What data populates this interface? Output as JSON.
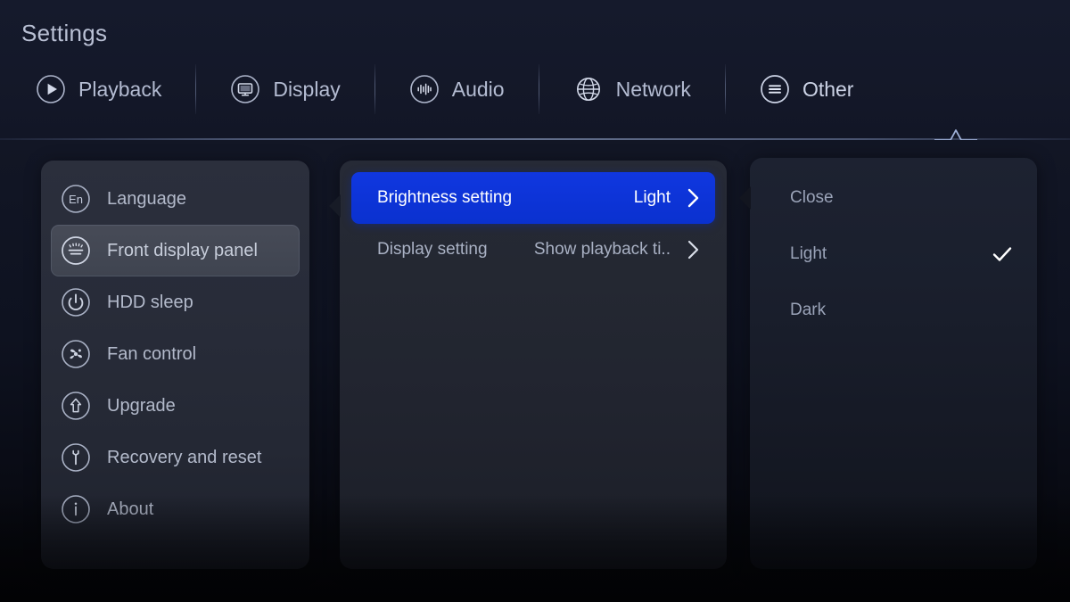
{
  "header": {
    "title": "Settings",
    "tabs": [
      {
        "label": "Playback",
        "icon": "play-circle-icon",
        "active": false
      },
      {
        "label": "Display",
        "icon": "monitor-icon",
        "active": false
      },
      {
        "label": "Audio",
        "icon": "audio-wave-icon",
        "active": false
      },
      {
        "label": "Network",
        "icon": "globe-icon",
        "active": false
      },
      {
        "label": "Other",
        "icon": "menu-lines-icon",
        "active": true
      }
    ]
  },
  "sidebar": {
    "items": [
      {
        "label": "Language",
        "icon": "language-en-icon",
        "selected": false
      },
      {
        "label": "Front display panel",
        "icon": "front-panel-icon",
        "selected": true
      },
      {
        "label": "HDD sleep",
        "icon": "power-icon",
        "selected": false
      },
      {
        "label": "Fan control",
        "icon": "fan-icon",
        "selected": false
      },
      {
        "label": "Upgrade",
        "icon": "upgrade-arrow-icon",
        "selected": false
      },
      {
        "label": "Recovery and reset",
        "icon": "wrench-icon",
        "selected": false
      },
      {
        "label": "About",
        "icon": "info-icon",
        "selected": false
      }
    ]
  },
  "settings": {
    "rows": [
      {
        "name": "Brightness setting",
        "value": "Light",
        "active": true,
        "chevron": "chevron-right-icon"
      },
      {
        "name": "Display setting",
        "value": "Show playback ti..",
        "active": false,
        "chevron": "chevron-right-icon"
      }
    ]
  },
  "options": {
    "items": [
      {
        "label": "Close",
        "checked": false
      },
      {
        "label": "Light",
        "checked": true
      },
      {
        "label": "Dark",
        "checked": false
      }
    ],
    "check_icon": "checkmark-icon"
  },
  "colors": {
    "accent_blue": "#0f36df",
    "header_bg": "#141829",
    "panel_bg": "#262a36",
    "sidebar_selected": "#474b57",
    "text_primary": "#c7cdda",
    "text_secondary": "#a9b1c4"
  }
}
